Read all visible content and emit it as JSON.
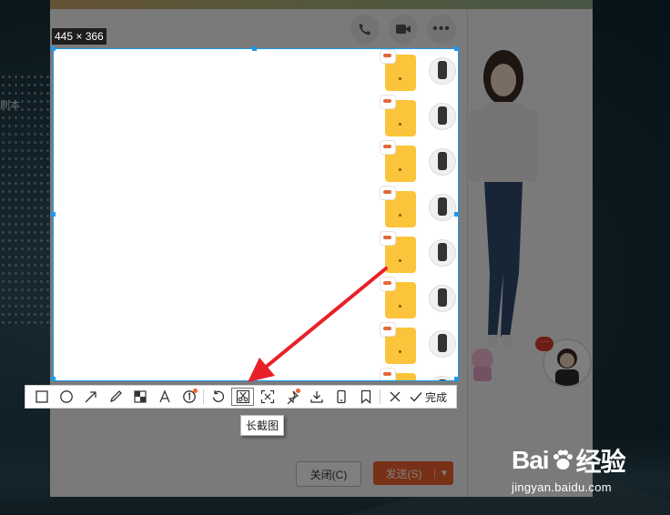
{
  "desktop": {
    "side_label": "刷本"
  },
  "screenshot_tool": {
    "size_label": "445 × 366",
    "tooltip": "长截图",
    "done_label": "完成",
    "tools": [
      {
        "name": "rectangle-tool",
        "icon": "rectangle-icon"
      },
      {
        "name": "ellipse-tool",
        "icon": "circle-icon"
      },
      {
        "name": "arrow-tool",
        "icon": "arrow-icon"
      },
      {
        "name": "pen-tool",
        "icon": "pencil-icon"
      },
      {
        "name": "mosaic-tool",
        "icon": "mosaic-icon"
      },
      {
        "name": "text-tool",
        "icon": "text-icon"
      },
      {
        "name": "number-tool",
        "icon": "numbered-circle-icon"
      },
      {
        "name": "undo-tool",
        "icon": "undo-icon"
      },
      {
        "name": "long-screenshot-tool",
        "icon": "scissors-icon"
      },
      {
        "name": "ocr-tool",
        "icon": "text-recognition-icon"
      },
      {
        "name": "pin-tool",
        "icon": "pin-icon"
      },
      {
        "name": "save-tool",
        "icon": "download-icon"
      },
      {
        "name": "phone-tool",
        "icon": "phone-icon"
      },
      {
        "name": "bookmark-tool",
        "icon": "bookmark-icon"
      },
      {
        "name": "cancel-tool",
        "icon": "close-icon"
      }
    ]
  },
  "chat": {
    "close_label": "关闭(C)",
    "send_label": "发送(S)",
    "header_icons": [
      "phone-icon",
      "video-icon",
      "more-icon"
    ],
    "bubble_dots": "···",
    "messages": [
      {
        "type": "sticker"
      },
      {
        "type": "sticker"
      },
      {
        "type": "sticker"
      },
      {
        "type": "sticker"
      },
      {
        "type": "sticker"
      },
      {
        "type": "sticker"
      },
      {
        "type": "sticker"
      },
      {
        "type": "sticker"
      }
    ]
  },
  "watermark": {
    "logo_left": "Bai",
    "logo_right": "经验",
    "url": "jingyan.baidu.com"
  },
  "colors": {
    "accent_blue": "#1a9bf0",
    "send_orange": "#f0612d",
    "arrow_red": "#e8202a"
  }
}
